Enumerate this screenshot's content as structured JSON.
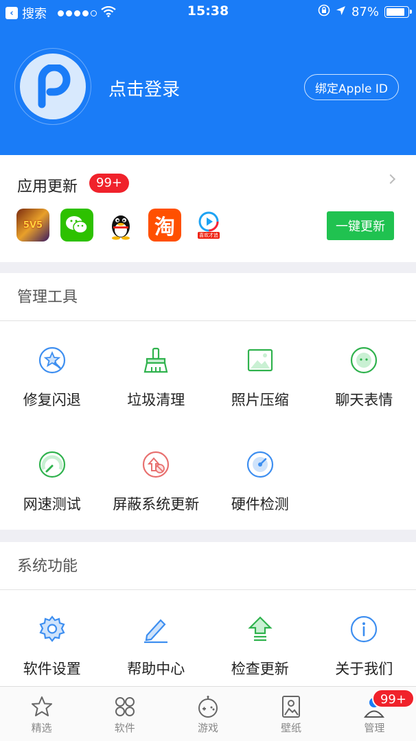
{
  "status_bar": {
    "back_label": "搜索",
    "time": "15:38",
    "battery": "87%",
    "battery_level": 0.87
  },
  "header": {
    "login_text": "点击登录",
    "apple_id_button": "绑定Apple ID",
    "accent": "#1a7cf7"
  },
  "updates": {
    "title": "应用更新",
    "badge": "99+",
    "apps": [
      {
        "name": "honor-of-kings-icon",
        "text": "5V5"
      },
      {
        "name": "wechat-icon",
        "text": ""
      },
      {
        "name": "qq-icon",
        "text": ""
      },
      {
        "name": "taobao-icon",
        "text": "淘"
      },
      {
        "name": "youku-icon",
        "text": "喜欢才追"
      }
    ],
    "one_key_button": "一键更新"
  },
  "tools": {
    "title": "管理工具",
    "items": [
      {
        "label": "修复闪退",
        "icon": "repair-icon"
      },
      {
        "label": "垃圾清理",
        "icon": "broom-icon"
      },
      {
        "label": "照片压缩",
        "icon": "photo-icon"
      },
      {
        "label": "聊天表情",
        "icon": "emoji-icon"
      },
      {
        "label": "网速测试",
        "icon": "speedometer-icon"
      },
      {
        "label": "屏蔽系统更新",
        "icon": "block-update-icon"
      },
      {
        "label": "硬件检测",
        "icon": "radar-icon"
      }
    ]
  },
  "system": {
    "title": "系统功能",
    "items": [
      {
        "label": "软件设置",
        "icon": "gear-icon"
      },
      {
        "label": "帮助中心",
        "icon": "pencil-icon"
      },
      {
        "label": "检查更新",
        "icon": "upload-arrow-icon"
      },
      {
        "label": "关于我们",
        "icon": "info-icon"
      }
    ]
  },
  "tabbar": {
    "tabs": [
      {
        "label": "精选",
        "icon": "star-icon"
      },
      {
        "label": "软件",
        "icon": "apps-grid-icon"
      },
      {
        "label": "游戏",
        "icon": "game-icon"
      },
      {
        "label": "壁纸",
        "icon": "wallpaper-icon"
      },
      {
        "label": "管理",
        "icon": "person-icon",
        "badge": "99+"
      }
    ]
  }
}
